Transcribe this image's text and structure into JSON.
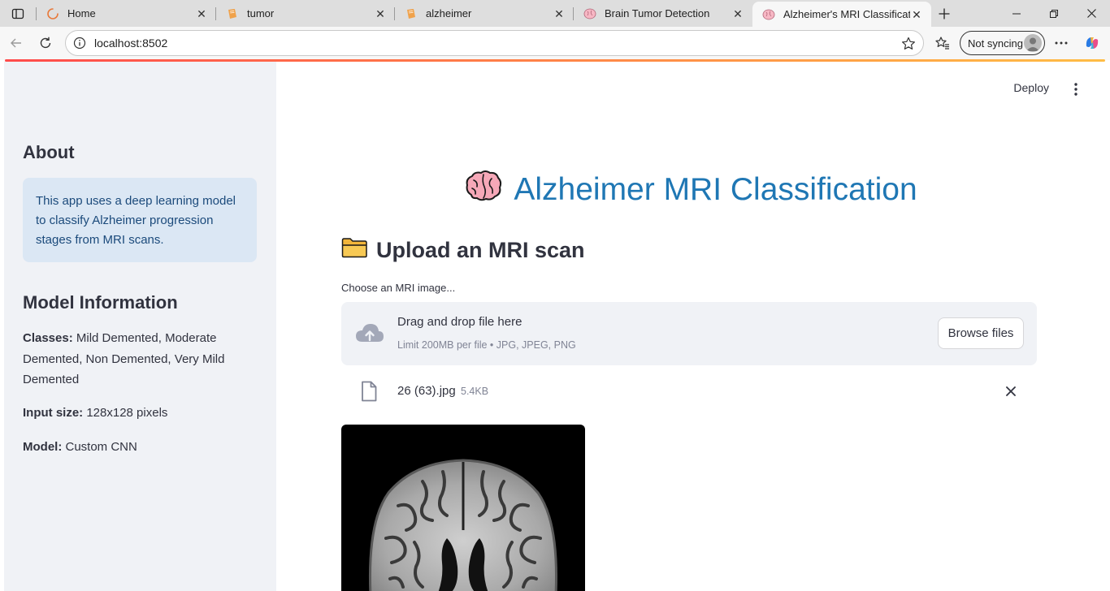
{
  "browser": {
    "tabs": [
      {
        "title": "Home",
        "icon": "loading-spinner-icon"
      },
      {
        "title": "tumor",
        "icon": "notebook-icon"
      },
      {
        "title": "alzheimer",
        "icon": "notebook-icon"
      },
      {
        "title": "Brain Tumor Detection",
        "icon": "brain-icon"
      },
      {
        "title": "Alzheimer's MRI Classification",
        "icon": "brain-icon"
      }
    ],
    "url": "localhost:8502",
    "sync_label": "Not syncing"
  },
  "sidebar": {
    "about_heading": "About",
    "about_text": "This app uses a deep learning model to classify Alzheimer progression stages from MRI scans.",
    "model_heading": "Model Information",
    "classes_label": "Classes:",
    "classes_value": " Mild Demented, Moderate Demented, Non Demented, Very Mild Demented",
    "input_label": "Input size:",
    "input_value": " 128x128 pixels",
    "model_label": "Model:",
    "model_value": " Custom CNN"
  },
  "header": {
    "deploy_label": "Deploy"
  },
  "main": {
    "title_emoji": "🧠",
    "title": "Alzheimer MRI Classification",
    "upload_emoji": "📁",
    "upload_heading": "Upload an MRI scan",
    "uploader_label": "Choose an MRI image...",
    "dropzone_text": "Drag and drop file here",
    "dropzone_limit": "Limit 200MB per file • JPG, JPEG, PNG",
    "browse_label": "Browse files",
    "file_name": "26 (63).jpg",
    "file_size": "5.4KB"
  },
  "colors": {
    "title_blue": "#1f77b4",
    "sidebar_bg": "#f0f2f6",
    "info_bg": "#dbe7f4",
    "info_text": "#1b4a7b",
    "text": "#31333f",
    "muted": "#808495",
    "accent_gradient_start": "#ff4b4b",
    "accent_gradient_end": "#ffbd45"
  }
}
